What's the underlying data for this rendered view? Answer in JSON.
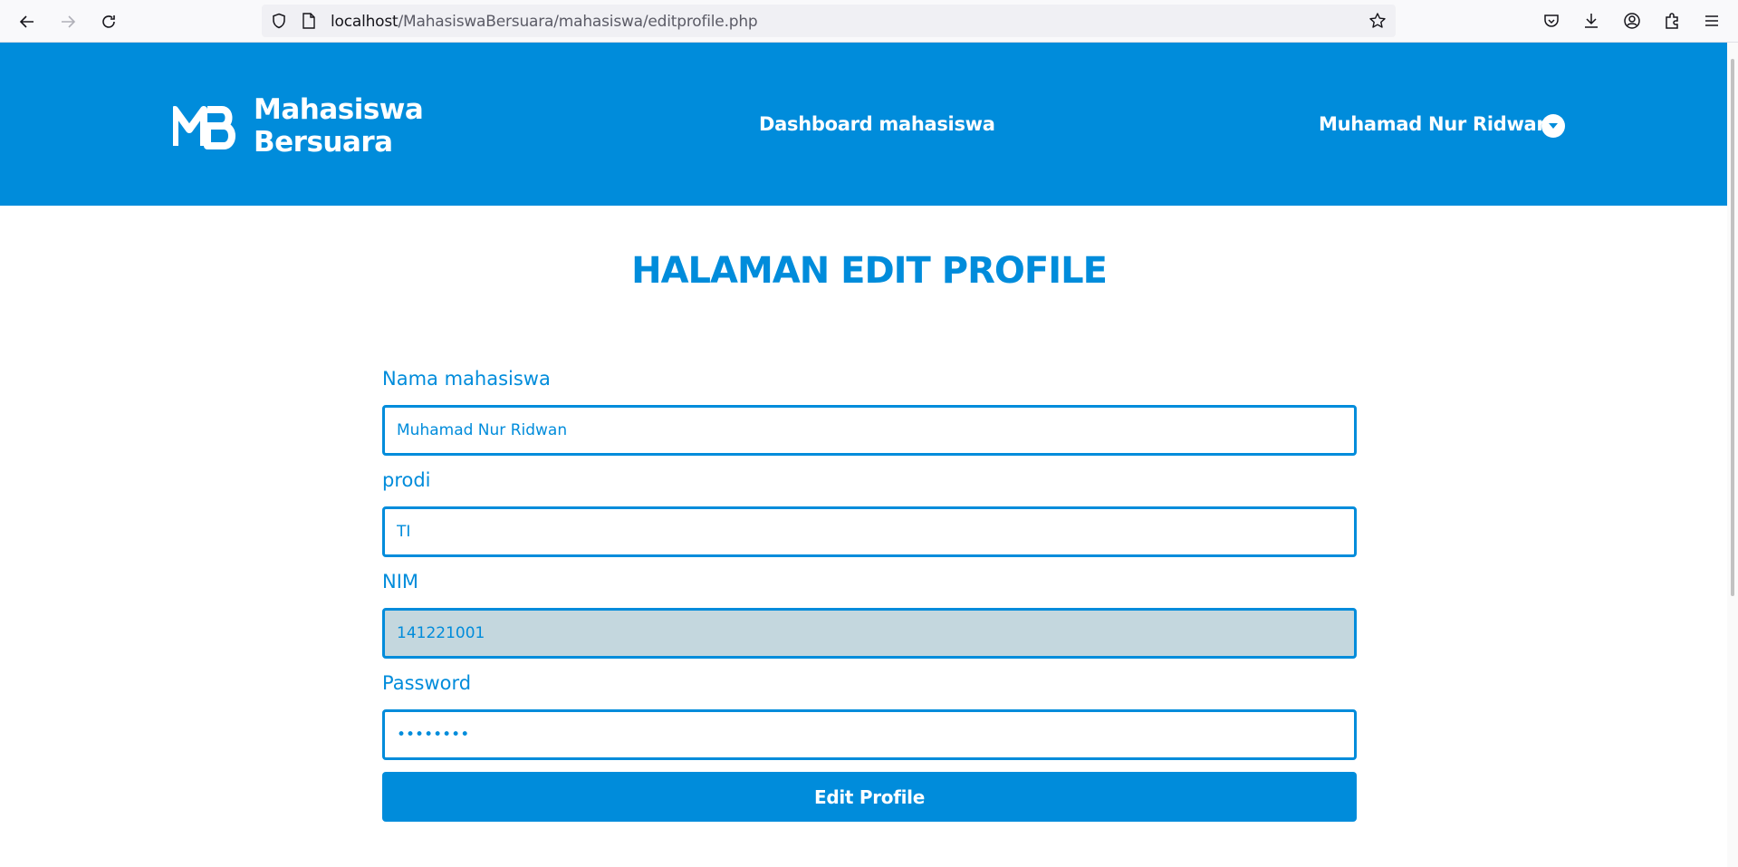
{
  "browser": {
    "url_host": "localhost",
    "url_path": "/MahasiswaBersuara/mahasiswa/editprofile.php"
  },
  "header": {
    "brand_line1": "Mahasiswa",
    "brand_line2": "Bersuara",
    "nav_link": "Dashboard mahasiswa",
    "user_name": "Muhamad Nur Ridwan"
  },
  "form": {
    "title": "HALAMAN EDIT PROFILE",
    "fields": [
      {
        "label": "Nama mahasiswa",
        "value": "Muhamad Nur Ridwan"
      },
      {
        "label": "prodi",
        "value": "TI"
      },
      {
        "label": "NIM",
        "value": "141221001"
      },
      {
        "label": "Password",
        "value": "••••••••"
      }
    ],
    "submit_label": "Edit Profile"
  },
  "colors": {
    "primary": "#008cdb",
    "readonly_bg": "#c4d7de"
  }
}
